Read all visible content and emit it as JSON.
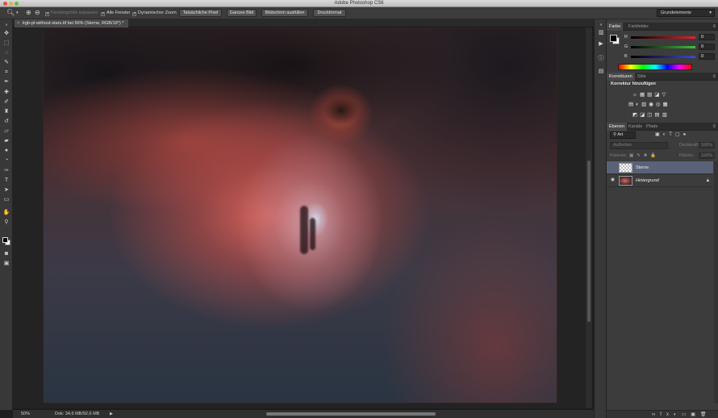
{
  "window": {
    "title": "Adobe Photoshop CS6"
  },
  "options_bar": {
    "resize_windows": "Fenstergröße anpassen",
    "all_windows": "Alle Fenster",
    "dynamic_zoom": "Dynamischer Zoom",
    "actual_pixels": "Tatsächliche Pixel",
    "fit_screen": "Ganzes Bild",
    "fill_screen": "Bildschirm ausfüllen",
    "print_size": "Druckformat",
    "workspace": "Grundelemente"
  },
  "document": {
    "tab_label": "lrgb-pl-without-stars.tif bei 50% (Sterne, RGB/16*) *",
    "close": "×"
  },
  "status_bar": {
    "zoom": "50%",
    "doc_info": "Dok: 34,6 MB/92,6 MB",
    "arrow": "▶"
  },
  "color_panel": {
    "tabs": [
      "Farbe",
      "Farbfelder"
    ],
    "r_label": "R",
    "g_label": "G",
    "b_label": "B",
    "r_value": "0",
    "g_value": "0",
    "b_value": "0",
    "colors": {
      "r_track": "#e0242a",
      "g_track": "#3cc43c",
      "b_track": "#3b49d6"
    }
  },
  "adjustments_panel": {
    "tabs": [
      "Korrekturen",
      "Stile"
    ],
    "title": "Korrektur hinzufügen",
    "row1": "☼▦▨◪▽",
    "row2": "▤◐▥◉◎▦",
    "row3": "◩◪◫▤▥"
  },
  "layers_panel": {
    "tabs": [
      "Ebenen",
      "Kanäle",
      "Pfade"
    ],
    "kind": "Art",
    "filter_icons": "▣◐T▢●",
    "blend_mode": "Aufhellen",
    "opacity_label": "Deckkraft:",
    "opacity_value": "100%",
    "lock_label": "Fixieren:",
    "lock_icons": "▦✎✚🔒",
    "fill_label": "Fläche:",
    "fill_value": "100%",
    "layers": [
      {
        "name": "Sterne"
      },
      {
        "name": "Hintergrund"
      }
    ],
    "foot_icons": "∞fx◐▭▣🗑"
  }
}
